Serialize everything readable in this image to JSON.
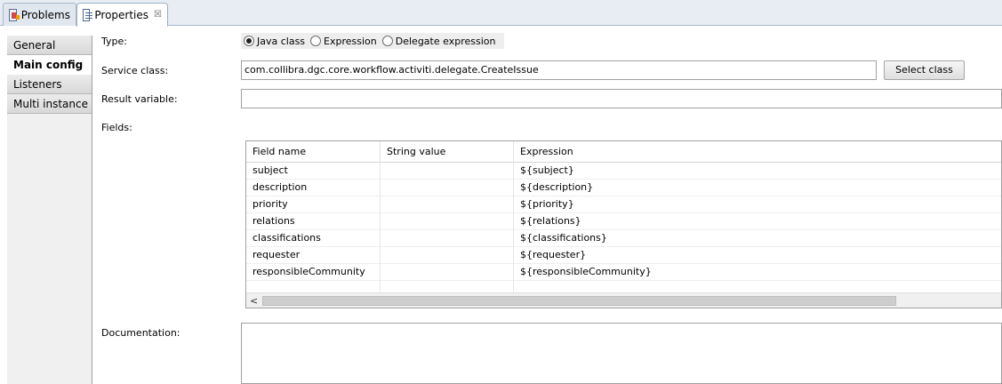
{
  "tabs": [
    {
      "label": "Problems",
      "icon": "problems-icon"
    },
    {
      "label": "Properties",
      "icon": "properties-icon",
      "close": "☒"
    }
  ],
  "side_tabs": [
    {
      "label": "General"
    },
    {
      "label": "Main config",
      "active": true
    },
    {
      "label": "Listeners"
    },
    {
      "label": "Multi instance"
    }
  ],
  "form": {
    "type_label": "Type:",
    "type_options": [
      "Java class",
      "Expression",
      "Delegate expression"
    ],
    "type_selected": "Java class",
    "service_class_label": "Service class:",
    "service_class_value": "com.collibra.dgc.core.workflow.activiti.delegate.CreateIssue",
    "select_class_button": "Select class",
    "result_variable_label": "Result variable:",
    "result_variable_value": "",
    "fields_label": "Fields:",
    "documentation_label": "Documentation:",
    "documentation_value": ""
  },
  "fields_table": {
    "columns": [
      "Field name",
      "String value",
      "Expression"
    ],
    "rows": [
      [
        "subject",
        "",
        "${subject}"
      ],
      [
        "description",
        "",
        "${description}"
      ],
      [
        "priority",
        "",
        "${priority}"
      ],
      [
        "relations",
        "",
        "${relations}"
      ],
      [
        "classifications",
        "",
        "${classifications}"
      ],
      [
        "requester",
        "",
        "${requester}"
      ],
      [
        "responsibleCommunity",
        "",
        "${responsibleCommunity}"
      ]
    ],
    "scroll_left_arrow": "<"
  }
}
